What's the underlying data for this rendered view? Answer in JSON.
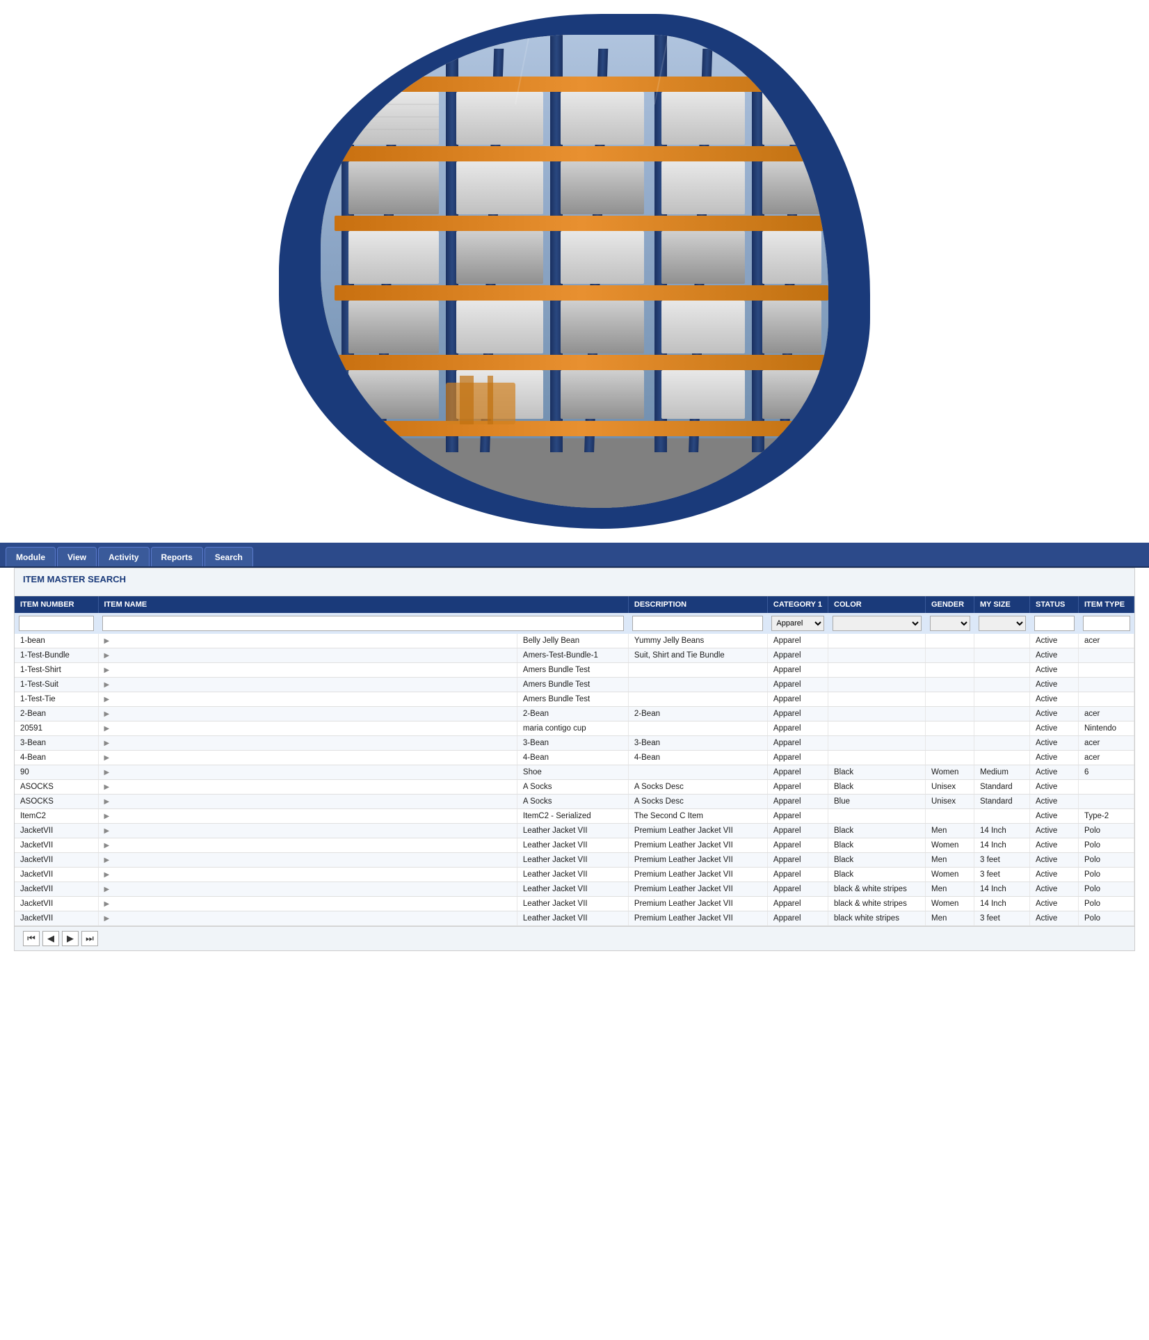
{
  "hero": {
    "alt": "Warehouse shelving with orange racks"
  },
  "nav": {
    "tabs": [
      {
        "id": "module",
        "label": "Module"
      },
      {
        "id": "view",
        "label": "View"
      },
      {
        "id": "activity",
        "label": "Activity"
      },
      {
        "id": "reports",
        "label": "Reports"
      },
      {
        "id": "search",
        "label": "Search"
      }
    ]
  },
  "search": {
    "title": "ITEM MASTER SEARCH"
  },
  "table": {
    "columns": [
      {
        "id": "item_number",
        "label": "ITEM NUMBER"
      },
      {
        "id": "item_name",
        "label": "ITEM NAME"
      },
      {
        "id": "description",
        "label": "DESCRIPTION"
      },
      {
        "id": "category1",
        "label": "CATEGORY 1"
      },
      {
        "id": "color",
        "label": "COLOR"
      },
      {
        "id": "gender",
        "label": "GENDER"
      },
      {
        "id": "my_size",
        "label": "MY SIZE"
      },
      {
        "id": "status",
        "label": "STATUS"
      },
      {
        "id": "item_type",
        "label": "ITEM TYPE"
      }
    ],
    "filters": {
      "category1_default": "Apparel",
      "color_placeholder": "",
      "gender_placeholder": "",
      "my_size_placeholder": ""
    },
    "rows": [
      {
        "item_number": "1-bean",
        "item_name": "Belly Jelly Bean",
        "description": "Yummy Jelly Beans",
        "category1": "Apparel",
        "color": "",
        "gender": "",
        "my_size": "",
        "status": "Active",
        "item_type": "acer"
      },
      {
        "item_number": "1-Test-Bundle",
        "item_name": "Amers-Test-Bundle-1",
        "description": "Suit, Shirt and Tie Bundle",
        "category1": "Apparel",
        "color": "",
        "gender": "",
        "my_size": "",
        "status": "Active",
        "item_type": ""
      },
      {
        "item_number": "1-Test-Shirt",
        "item_name": "Amers Bundle Test",
        "description": "",
        "category1": "Apparel",
        "color": "",
        "gender": "",
        "my_size": "",
        "status": "Active",
        "item_type": ""
      },
      {
        "item_number": "1-Test-Suit",
        "item_name": "Amers Bundle Test",
        "description": "",
        "category1": "Apparel",
        "color": "",
        "gender": "",
        "my_size": "",
        "status": "Active",
        "item_type": ""
      },
      {
        "item_number": "1-Test-Tie",
        "item_name": "Amers Bundle Test",
        "description": "",
        "category1": "Apparel",
        "color": "",
        "gender": "",
        "my_size": "",
        "status": "Active",
        "item_type": ""
      },
      {
        "item_number": "2-Bean",
        "item_name": "2-Bean",
        "description": "2-Bean",
        "category1": "Apparel",
        "color": "",
        "gender": "",
        "my_size": "",
        "status": "Active",
        "item_type": "acer"
      },
      {
        "item_number": "20591",
        "item_name": "maria contigo cup",
        "description": "",
        "category1": "Apparel",
        "color": "",
        "gender": "",
        "my_size": "",
        "status": "Active",
        "item_type": "Nintendo"
      },
      {
        "item_number": "3-Bean",
        "item_name": "3-Bean",
        "description": "3-Bean",
        "category1": "Apparel",
        "color": "",
        "gender": "",
        "my_size": "",
        "status": "Active",
        "item_type": "acer"
      },
      {
        "item_number": "4-Bean",
        "item_name": "4-Bean",
        "description": "4-Bean",
        "category1": "Apparel",
        "color": "",
        "gender": "",
        "my_size": "",
        "status": "Active",
        "item_type": "acer"
      },
      {
        "item_number": "90",
        "item_name": "Shoe",
        "description": "",
        "category1": "Apparel",
        "color": "Black",
        "gender": "Women",
        "my_size": "Medium",
        "status": "Active",
        "item_type": "6"
      },
      {
        "item_number": "ASOCKS",
        "item_name": "A Socks",
        "description": "A Socks Desc",
        "category1": "Apparel",
        "color": "Black",
        "gender": "Unisex",
        "my_size": "Standard",
        "status": "Active",
        "item_type": ""
      },
      {
        "item_number": "ASOCKS",
        "item_name": "A Socks",
        "description": "A Socks Desc",
        "category1": "Apparel",
        "color": "Blue",
        "gender": "Unisex",
        "my_size": "Standard",
        "status": "Active",
        "item_type": ""
      },
      {
        "item_number": "ItemC2",
        "item_name": "ItemC2 - Serialized",
        "description": "The Second C Item",
        "category1": "Apparel",
        "color": "",
        "gender": "",
        "my_size": "",
        "status": "Active",
        "item_type": "Type-2"
      },
      {
        "item_number": "JacketVII",
        "item_name": "Leather Jacket VII",
        "description": "Premium Leather Jacket VII",
        "category1": "Apparel",
        "color": "Black",
        "gender": "Men",
        "my_size": "14 Inch",
        "status": "Active",
        "item_type": "Polo"
      },
      {
        "item_number": "JacketVII",
        "item_name": "Leather Jacket VII",
        "description": "Premium Leather Jacket VII",
        "category1": "Apparel",
        "color": "Black",
        "gender": "Women",
        "my_size": "14 Inch",
        "status": "Active",
        "item_type": "Polo"
      },
      {
        "item_number": "JacketVII",
        "item_name": "Leather Jacket VII",
        "description": "Premium Leather Jacket VII",
        "category1": "Apparel",
        "color": "Black",
        "gender": "Men",
        "my_size": "3 feet",
        "status": "Active",
        "item_type": "Polo"
      },
      {
        "item_number": "JacketVII",
        "item_name": "Leather Jacket VII",
        "description": "Premium Leather Jacket VII",
        "category1": "Apparel",
        "color": "Black",
        "gender": "Women",
        "my_size": "3 feet",
        "status": "Active",
        "item_type": "Polo"
      },
      {
        "item_number": "JacketVII",
        "item_name": "Leather Jacket VII",
        "description": "Premium Leather Jacket VII",
        "category1": "Apparel",
        "color": "black & white stripes",
        "gender": "Men",
        "my_size": "14 Inch",
        "status": "Active",
        "item_type": "Polo"
      },
      {
        "item_number": "JacketVII",
        "item_name": "Leather Jacket VII",
        "description": "Premium Leather Jacket VII",
        "category1": "Apparel",
        "color": "black & white stripes",
        "gender": "Women",
        "my_size": "14 Inch",
        "status": "Active",
        "item_type": "Polo"
      },
      {
        "item_number": "JacketVII",
        "item_name": "Leather Jacket VII",
        "description": "Premium Leather Jacket VII",
        "category1": "Apparel",
        "color": "black white stripes",
        "gender": "Men",
        "my_size": "3 feet",
        "status": "Active",
        "item_type": "Polo"
      }
    ]
  },
  "pagination": {
    "first_label": "⏮",
    "prev_label": "◀",
    "next_label": "▶",
    "last_label": "⏭"
  }
}
